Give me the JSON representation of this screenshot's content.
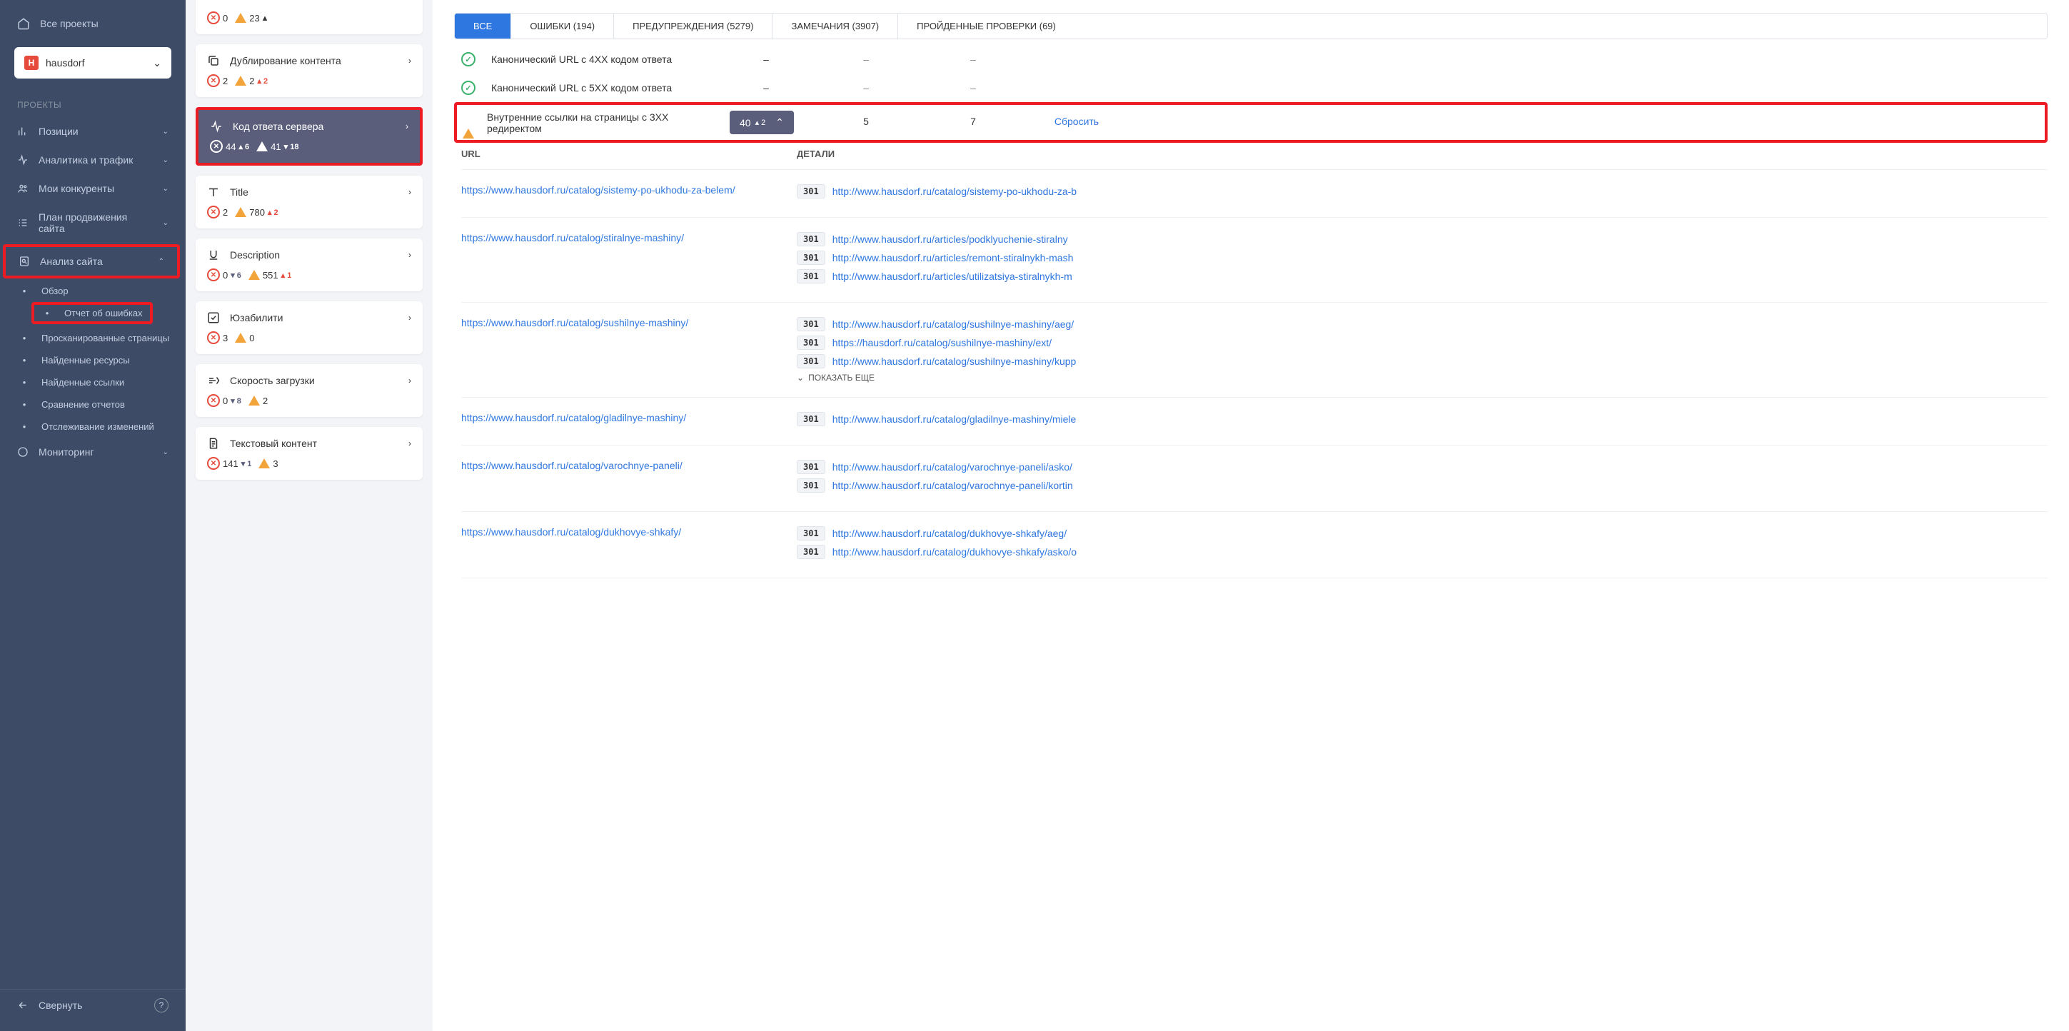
{
  "sidebar": {
    "all_projects": "Все проекты",
    "project_name": "hausdorf",
    "section_label": "ПРОЕКТЫ",
    "items": {
      "positions": "Позиции",
      "analytics": "Аналитика и трафик",
      "competitors": "Мои конкуренты",
      "promo_plan": "План продвижения сайта",
      "site_analysis": "Анализ сайта",
      "monitoring": "Мониторинг"
    },
    "sub_items": {
      "overview": "Обзор",
      "error_report": "Отчет об ошибках",
      "crawled_pages": "Просканированные страницы",
      "found_resources": "Найденные ресурсы",
      "found_links": "Найденные ссылки",
      "compare_reports": "Сравнение отчетов",
      "track_changes": "Отслеживание изменений"
    },
    "collapse": "Свернуть"
  },
  "categories": {
    "first_partial": {
      "err": "0",
      "warn": "23"
    },
    "dup": {
      "title": "Дублирование контента",
      "err": "2",
      "warn": "2",
      "d": "▴ 2"
    },
    "server": {
      "title": "Код ответа сервера",
      "err": "44",
      "d1": "▴ 6",
      "warn": "41",
      "d2": "▾ 18"
    },
    "title_cat": {
      "title": "Title",
      "err": "2",
      "warn": "780",
      "d": "▴ 2"
    },
    "desc": {
      "title": "Description",
      "err": "0",
      "d1": "▾ 6",
      "warn": "551",
      "d2": "▴ 1"
    },
    "usab": {
      "title": "Юзабилити",
      "err": "3",
      "warn": "0"
    },
    "speed": {
      "title": "Скорость загрузки",
      "err": "0",
      "d1": "▾ 8",
      "warn": "2"
    },
    "text": {
      "title": "Текстовый контент",
      "err": "141",
      "d1": "▾ 1",
      "warn": "3"
    }
  },
  "tabs": {
    "all": "ВСЕ",
    "errors": "ОШИБКИ (194)",
    "warnings": "ПРЕДУПРЕЖДЕНИЯ (5279)",
    "notices": "ЗАМЕЧАНИЯ (3907)",
    "passed": "ПРОЙДЕННЫЕ ПРОВЕРКИ (69)"
  },
  "issues": {
    "c4xx": "Канонический URL с 4XX кодом ответа",
    "c5xx": "Канонический URL с 5XX кодом ответа",
    "i3xx": "Внутренние ссылки на страницы с 3XX редиректом",
    "count": "40",
    "delta": "▴ 2",
    "v5": "5",
    "v7": "7",
    "reset": "Сбросить",
    "dash": "–"
  },
  "table": {
    "url_header": "URL",
    "details_header": "ДЕТАЛИ",
    "show_more": "ПОКАЗАТЬ ЕЩЕ",
    "rows": [
      {
        "url": "https://www.hausdorf.ru/catalog/sistemy-po-ukhodu-za-belem/",
        "details": [
          {
            "code": "301",
            "link": "http://www.hausdorf.ru/catalog/sistemy-po-ukhodu-za-b"
          }
        ]
      },
      {
        "url": "https://www.hausdorf.ru/catalog/stiralnye-mashiny/",
        "details": [
          {
            "code": "301",
            "link": "http://www.hausdorf.ru/articles/podklyuchenie-stiralny"
          },
          {
            "code": "301",
            "link": "http://www.hausdorf.ru/articles/remont-stiralnykh-mash"
          },
          {
            "code": "301",
            "link": "http://www.hausdorf.ru/articles/utilizatsiya-stiralnykh-m"
          }
        ]
      },
      {
        "url": "https://www.hausdorf.ru/catalog/sushilnye-mashiny/",
        "details": [
          {
            "code": "301",
            "link": "http://www.hausdorf.ru/catalog/sushilnye-mashiny/aeg/"
          },
          {
            "code": "301",
            "link": "https://hausdorf.ru/catalog/sushilnye-mashiny/ext/"
          },
          {
            "code": "301",
            "link": "http://www.hausdorf.ru/catalog/sushilnye-mashiny/kupp"
          }
        ],
        "more": true
      },
      {
        "url": "https://www.hausdorf.ru/catalog/gladilnye-mashiny/",
        "details": [
          {
            "code": "301",
            "link": "http://www.hausdorf.ru/catalog/gladilnye-mashiny/miele"
          }
        ]
      },
      {
        "url": "https://www.hausdorf.ru/catalog/varochnye-paneli/",
        "details": [
          {
            "code": "301",
            "link": "http://www.hausdorf.ru/catalog/varochnye-paneli/asko/"
          },
          {
            "code": "301",
            "link": "http://www.hausdorf.ru/catalog/varochnye-paneli/kortin"
          }
        ]
      },
      {
        "url": "https://www.hausdorf.ru/catalog/dukhovye-shkafy/",
        "details": [
          {
            "code": "301",
            "link": "http://www.hausdorf.ru/catalog/dukhovye-shkafy/aeg/"
          },
          {
            "code": "301",
            "link": "http://www.hausdorf.ru/catalog/dukhovye-shkafy/asko/o"
          }
        ]
      }
    ]
  }
}
